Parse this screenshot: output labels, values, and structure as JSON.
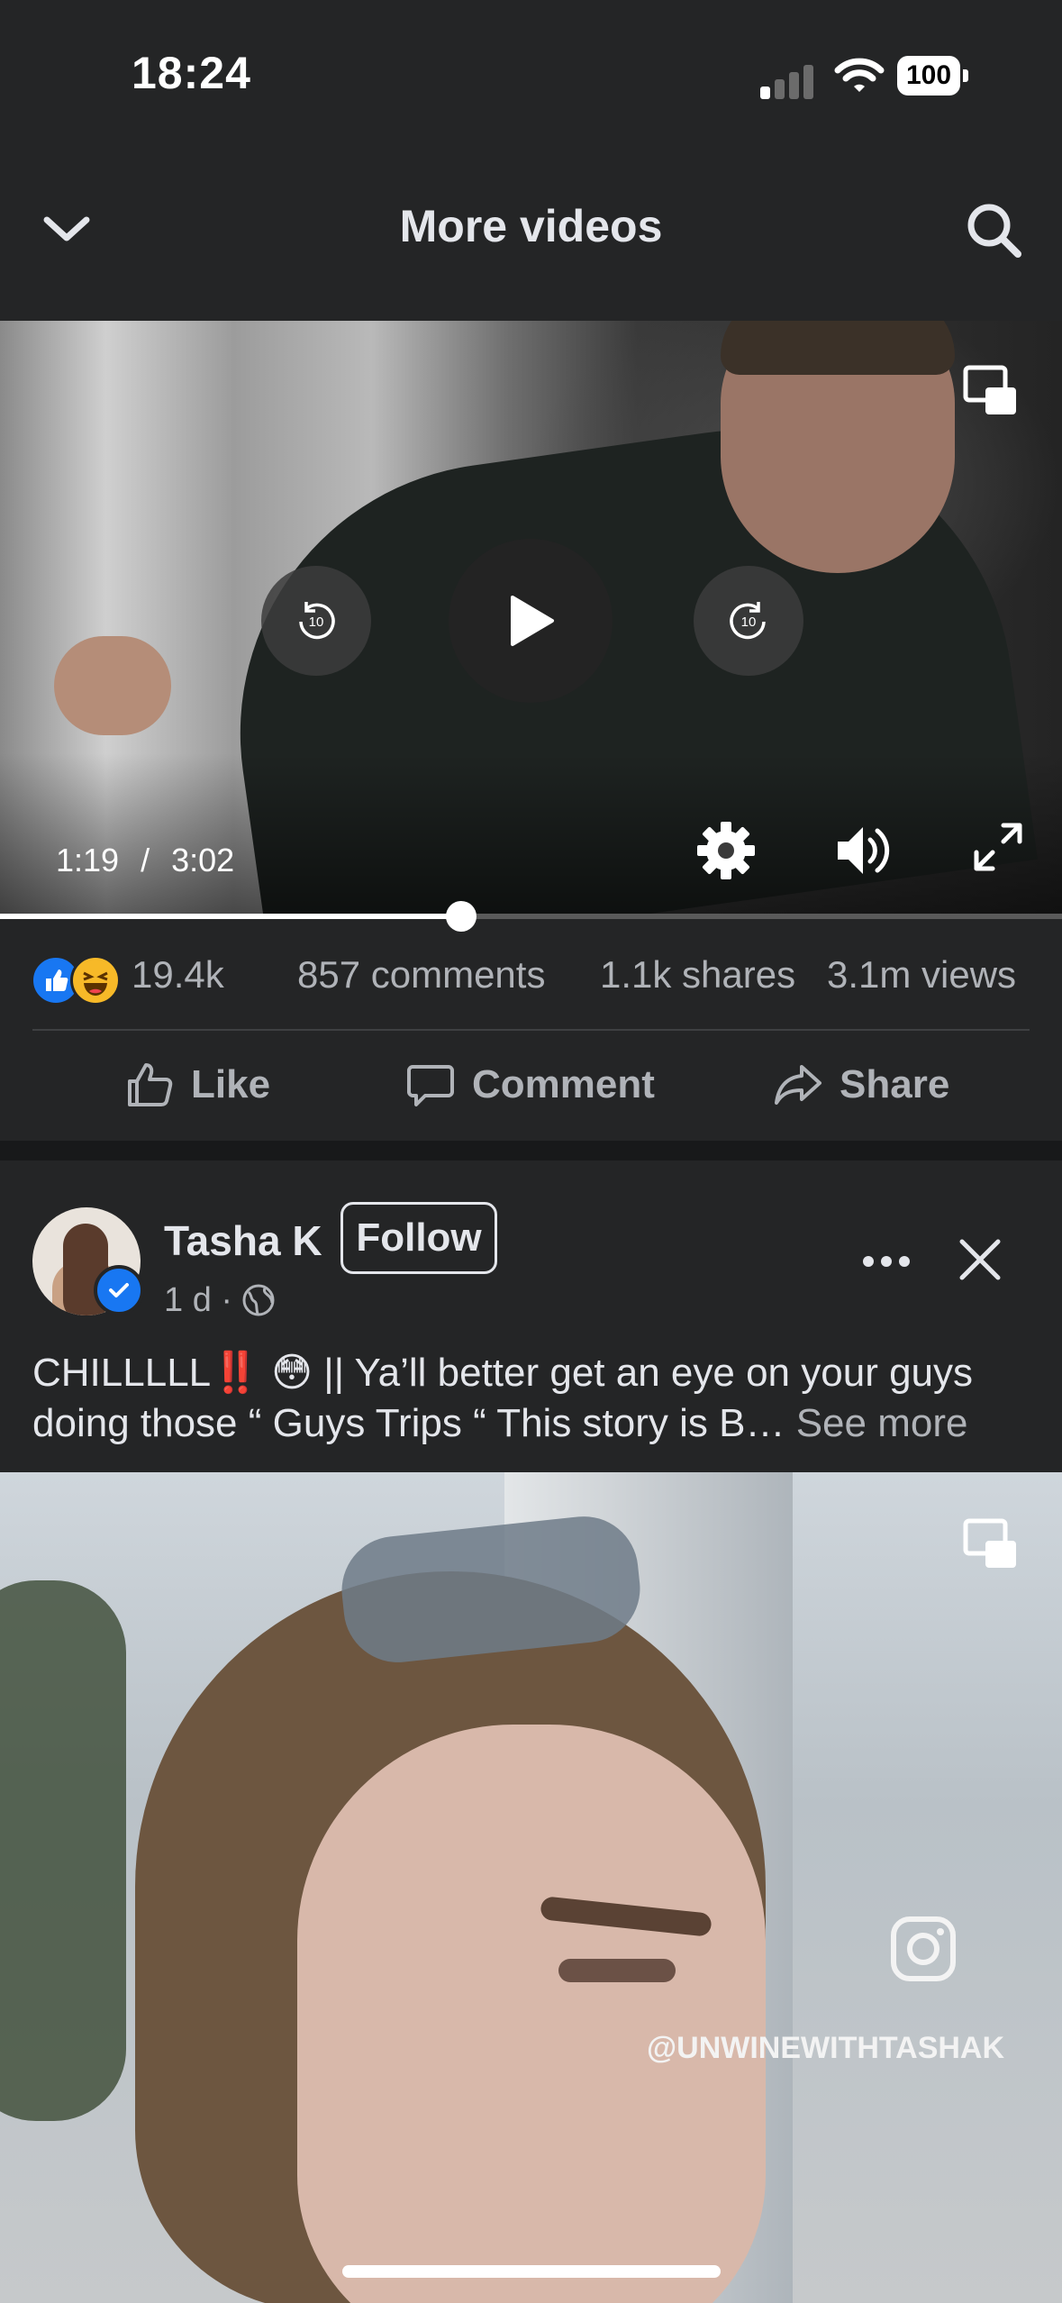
{
  "status_bar": {
    "time": "18:24",
    "battery": "100"
  },
  "header": {
    "title": "More videos"
  },
  "video1": {
    "current_time": "1:19",
    "time_separator": "/",
    "duration": "3:02",
    "progress": 0.434
  },
  "stats": {
    "reactions_count": "19.4k",
    "comments": "857 comments",
    "shares": "1.1k shares",
    "views": "3.1m views"
  },
  "actions": {
    "like": "Like",
    "comment": "Comment",
    "share": "Share"
  },
  "post": {
    "author": "Tasha K",
    "follow_label": "Follow",
    "time": "1 d ·",
    "caption": "CHILLLLL‼️ 😳 || Ya’ll better get an eye on your guys doing those “ Guys Trips “  This story is B…",
    "see_more": "See more"
  },
  "video2": {
    "watermark": "@UNWINEWITHTASHAK"
  },
  "colors": {
    "background": "#242526",
    "accent": "#1877f2",
    "muted_text": "#b0b3b8"
  },
  "icons": [
    "chevron-down-icon",
    "search-icon",
    "pip-icon",
    "rewind-10-icon",
    "play-icon",
    "forward-10-icon",
    "gear-icon",
    "volume-icon",
    "fullscreen-icon",
    "like-icon",
    "comment-icon",
    "share-icon",
    "globe-icon",
    "more-icon",
    "close-icon",
    "instagram-icon"
  ]
}
